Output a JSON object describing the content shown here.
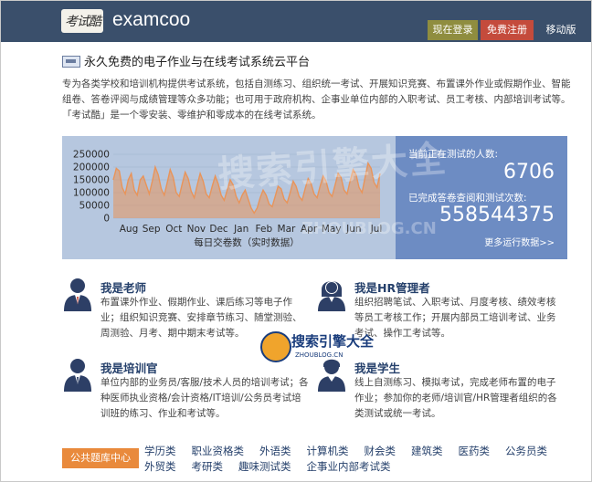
{
  "header": {
    "logo_text": "考试酷",
    "brand": "examcoo",
    "login_label": "现在登录",
    "register_label": "免费注册",
    "mobile_label": "移动版",
    "bg_color": "#3a4f6b"
  },
  "intro": {
    "title": "永久免费的电子作业与在线考试系统云平台",
    "text": "专为各类学校和培训机构提供考试系统，包括自测练习、组织统一考试、开展知识竞赛、布置课外作业或假期作业、智能组卷、答卷评阅与成绩管理等众多功能；也可用于政府机构、企事业单位内部的入职考试、员工考核、内部培训考试等。「考试酷」是一个零安装、零维护和零成本的在线考试系统。"
  },
  "chart_data": {
    "type": "area",
    "title": "每日交卷数（实时数据）",
    "xlabel": "每日交卷数（实时数据）",
    "ylabel": "",
    "x_ticks": [
      "Aug",
      "Sep",
      "Oct",
      "Nov",
      "Dec",
      "Jan",
      "Feb",
      "Mar",
      "Apr",
      "May",
      "Jun",
      "Jul"
    ],
    "y_ticks": [
      0,
      50000,
      100000,
      150000,
      200000,
      250000
    ],
    "ylim": [
      0,
      250000
    ],
    "grid": true,
    "color": "#e8945a",
    "series": [
      {
        "values": [
          150000,
          195000,
          185000,
          120000,
          95000,
          150000,
          175000,
          110000,
          90000,
          150000,
          165000,
          130000,
          95000,
          145000,
          200000,
          170000,
          115000,
          90000,
          140000,
          190000,
          160000,
          100000,
          85000,
          135000,
          180000,
          155000,
          105000,
          80000,
          130000,
          175000,
          145000,
          95000,
          80000,
          125000,
          165000,
          135000,
          90000,
          70000,
          110000,
          150000,
          130000,
          85000,
          60000,
          90000,
          110000,
          75000,
          40000,
          20000,
          40000,
          80000,
          110000,
          90000,
          55000,
          45000,
          85000,
          125000,
          115000,
          75000,
          60000,
          100000,
          145000,
          125000,
          85000,
          70000,
          115000,
          155000,
          135000,
          95000,
          80000,
          125000,
          165000,
          145000,
          100000,
          85000,
          130000,
          175000,
          160000,
          110000,
          95000,
          145000,
          190000,
          170000,
          120000,
          100000,
          160000,
          215000,
          195000,
          140000,
          120000,
          175000
        ]
      }
    ]
  },
  "stats": {
    "label_testing": "当前正在测试的人数:",
    "value_testing": "6706",
    "label_done": "已完成答卷查阅和测试次数:",
    "value_done": "558544375",
    "more_link": "更多运行数据>>"
  },
  "roles": {
    "teacher": {
      "title": "我是老师",
      "desc": "布置课外作业、假期作业、课后练习等电子作业；组织知识竞赛、安排章节练习、随堂测验、周测验、月考、期中期末考试等。",
      "icon": "teacher-avatar-icon"
    },
    "hr": {
      "title": "我是HR管理者",
      "desc": "组织招聘笔试、入职考试、月度考核、绩效考核等员工考核工作；开展内部员工培训考试、业务考试、操作工考试等。",
      "icon": "hr-avatar-icon"
    },
    "trainer": {
      "title": "我是培训官",
      "desc": "单位内部的业务员/客服/技术人员的培训考试；各种医师执业资格/会计资格/IT培训/公务员考试培训班的练习、作业和考试等。",
      "icon": "trainer-avatar-icon"
    },
    "student": {
      "title": "我是学生",
      "desc": "线上自测练习、模拟考试，完成老师布置的电子作业；参加你的老师/培训官/HR管理者组织的各类测试或统一考试。",
      "icon": "student-avatar-icon"
    }
  },
  "categories": {
    "center_label": "公共题库中心",
    "items": [
      "学历类",
      "职业资格类",
      "外语类",
      "计算机类",
      "财会类",
      "建筑类",
      "医药类",
      "公务员类",
      "外贸类",
      "考研类",
      "趣味测试类",
      "企事业内部考试类"
    ]
  },
  "watermarks": {
    "wm1_text": "搜索引擎大全",
    "wm1_sub": "ZHOUBLOG.CN",
    "wm2_text": "搜索引擎大全",
    "wm2_sub": "ZHOUBLOG.CN"
  }
}
